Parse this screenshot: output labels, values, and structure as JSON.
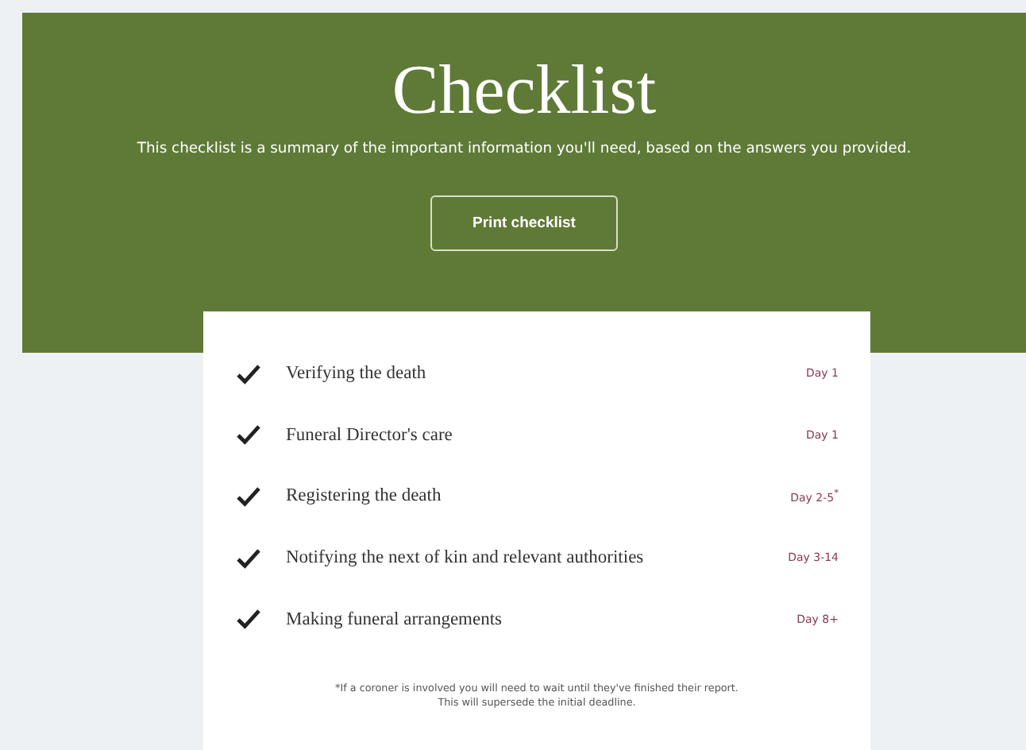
{
  "header": {
    "title": "Checklist",
    "subtitle": "This checklist is a summary of the important information you'll need, based on the answers you provided.",
    "button": "Print checklist"
  },
  "items": [
    {
      "label": "Verifying the death",
      "day": "Day 1",
      "checked": true
    },
    {
      "label": "Funeral Director's care",
      "day": "Day 1",
      "checked": true
    },
    {
      "label": "Registering the death",
      "day": "Day 2-5$^{*}$",
      "checked": true
    },
    {
      "label": "Notifying the next of kin and relevant authorities",
      "day": "Day 3-14",
      "checked": true
    },
    {
      "label": "Making funeral arrangements",
      "day": "Day 8+",
      "checked": true
    }
  ],
  "footnote": [
    "*If a coroner is involved you will need to wait until they've finished their report.",
    "This will supersede the initial deadline."
  ]
}
